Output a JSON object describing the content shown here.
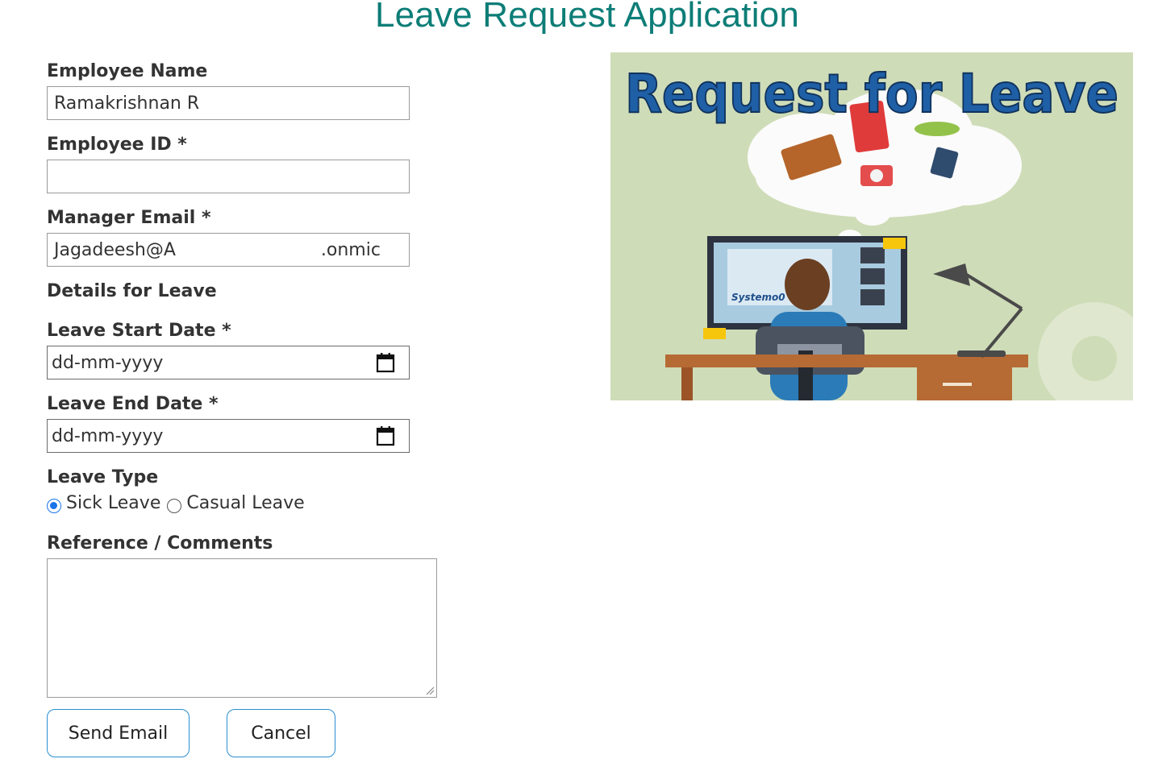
{
  "app": {
    "title": "Leave Request Application"
  },
  "form": {
    "employee_name_label": "Employee Name",
    "employee_name_value": "Ramakrishnan R",
    "employee_id_label": "Employee ID *",
    "employee_id_value": "",
    "manager_email_label": "Manager Email *",
    "manager_email_value_start": "Jagadeesh@A",
    "manager_email_value_end": ".onmic",
    "details_heading": "Details for Leave",
    "start_date_label": "Leave Start Date *",
    "start_date_placeholder": "dd-mm-yyyy",
    "end_date_label": "Leave End Date *",
    "end_date_placeholder": "dd-mm-yyyy",
    "leave_type_label": "Leave Type",
    "leave_type_options": [
      {
        "label": "Sick Leave",
        "selected": true
      },
      {
        "label": "Casual Leave",
        "selected": false
      }
    ],
    "comments_label": "Reference / Comments",
    "comments_value": ""
  },
  "buttons": {
    "send_label": "Send Email",
    "cancel_label": "Cancel"
  },
  "illustration": {
    "banner_text": "Request for Leave",
    "screen_text": "Systemo0"
  },
  "colors": {
    "title": "#0d7d77",
    "button_border": "#2a8fd1",
    "radio_accent": "#1a73e8",
    "banner_text": "#1f5fa6",
    "illustration_bg": "#cfdcb8"
  },
  "icons": {
    "date_picker": "calendar-icon"
  }
}
